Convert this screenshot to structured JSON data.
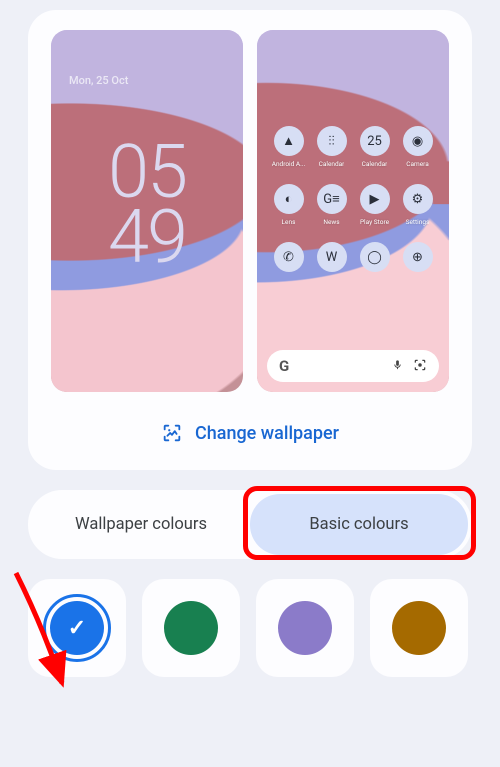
{
  "lock_screen": {
    "date": "Mon, 25 Oct",
    "clock_top": "05",
    "clock_bottom": "49"
  },
  "home_apps": [
    {
      "label": "Android A...",
      "glyph": "▲"
    },
    {
      "label": "Calendar",
      "glyph": "⫶⫶"
    },
    {
      "label": "Calendar",
      "glyph": "25"
    },
    {
      "label": "Camera",
      "glyph": "◉"
    },
    {
      "label": "Lens",
      "glyph": "◐"
    },
    {
      "label": "News",
      "glyph": "G≡"
    },
    {
      "label": "Play Store",
      "glyph": "▶"
    },
    {
      "label": "Settings",
      "glyph": "⚙"
    },
    {
      "label": "",
      "glyph": "✆"
    },
    {
      "label": "",
      "glyph": "W"
    },
    {
      "label": "",
      "glyph": "◯"
    },
    {
      "label": "",
      "glyph": "⊕"
    }
  ],
  "search": {
    "g": "G"
  },
  "change_wallpaper_label": "Change wallpaper",
  "tabs": {
    "wallpaper": "Wallpaper colours",
    "basic": "Basic colours"
  },
  "colors": {
    "c1": "#1a73e8",
    "c2": "#188050",
    "c3": "#8b7bc9",
    "c4": "#a56a00"
  }
}
